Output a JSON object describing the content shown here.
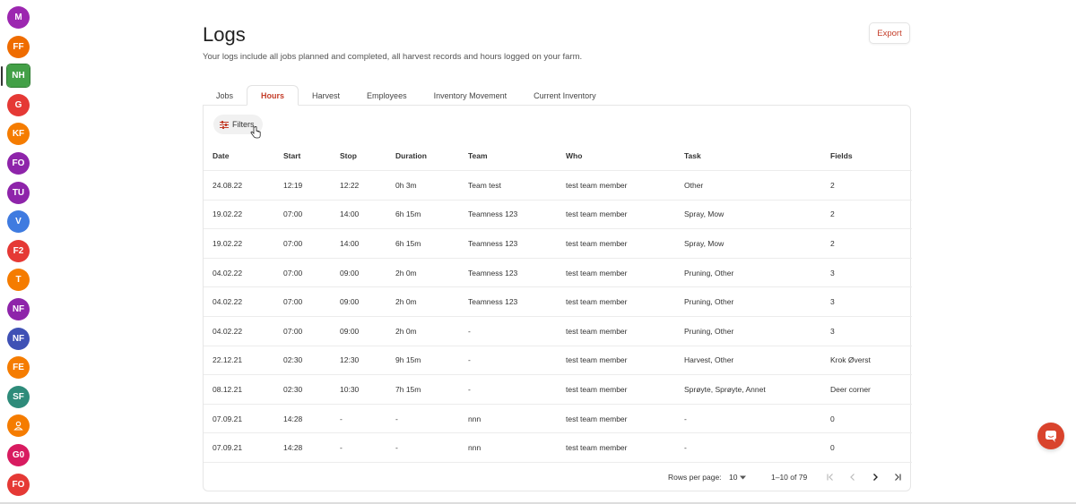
{
  "sidebar": {
    "items": [
      {
        "label": "M",
        "color": "#9c27b0"
      },
      {
        "label": "FF",
        "color": "#ef6c00"
      },
      {
        "label": "NH",
        "color": "#43a047",
        "active": true
      },
      {
        "label": "G",
        "color": "#e53935"
      },
      {
        "label": "KF",
        "color": "#f57c00"
      },
      {
        "label": "FO",
        "color": "#8e24aa"
      },
      {
        "label": "TU",
        "color": "#8e24aa"
      },
      {
        "label": "V",
        "color": "#3f7be0"
      },
      {
        "label": "F2",
        "color": "#e53935"
      },
      {
        "label": "T",
        "color": "#f57c00"
      },
      {
        "label": "NF",
        "color": "#8e24aa"
      },
      {
        "label": "NF",
        "color": "#3f51b5"
      },
      {
        "label": "FE",
        "color": "#f57c00"
      },
      {
        "label": "SF",
        "color": "#2e8b7a"
      },
      {
        "label": "",
        "color": "#f57c00",
        "icon": "user-icon"
      },
      {
        "label": "G0",
        "color": "#d81b60"
      },
      {
        "label": "FO",
        "color": "#e53935"
      }
    ]
  },
  "header": {
    "title": "Logs",
    "subtitle": "Your logs include all jobs planned and completed, all harvest records and hours logged on your farm.",
    "export_label": "Export"
  },
  "tabs": [
    {
      "label": "Jobs",
      "active": false
    },
    {
      "label": "Hours",
      "active": true
    },
    {
      "label": "Harvest",
      "active": false
    },
    {
      "label": "Employees",
      "active": false
    },
    {
      "label": "Inventory Movement",
      "active": false
    },
    {
      "label": "Current Inventory",
      "active": false
    }
  ],
  "filters_label": "Filters",
  "table": {
    "columns": [
      "Date",
      "Start",
      "Stop",
      "Duration",
      "Team",
      "Who",
      "Task",
      "Fields"
    ],
    "rows": [
      [
        "24.08.22",
        "12:19",
        "12:22",
        "0h 3m",
        "Team test",
        "test team member",
        "Other",
        "2"
      ],
      [
        "19.02.22",
        "07:00",
        "14:00",
        "6h 15m",
        "Teamness 123",
        "test team member",
        "Spray, Mow",
        "2"
      ],
      [
        "19.02.22",
        "07:00",
        "14:00",
        "6h 15m",
        "Teamness 123",
        "test team member",
        "Spray, Mow",
        "2"
      ],
      [
        "04.02.22",
        "07:00",
        "09:00",
        "2h 0m",
        "Teamness 123",
        "test team member",
        "Pruning, Other",
        "3"
      ],
      [
        "04.02.22",
        "07:00",
        "09:00",
        "2h 0m",
        "Teamness 123",
        "test team member",
        "Pruning, Other",
        "3"
      ],
      [
        "04.02.22",
        "07:00",
        "09:00",
        "2h 0m",
        "-",
        "test team member",
        "Pruning, Other",
        "3"
      ],
      [
        "22.12.21",
        "02:30",
        "12:30",
        "9h 15m",
        "-",
        "test team member",
        "Harvest, Other",
        "Krok Øverst"
      ],
      [
        "08.12.21",
        "02:30",
        "10:30",
        "7h 15m",
        "-",
        "test team member",
        "Sprøyte, Sprøyte, Annet",
        "Deer corner"
      ],
      [
        "07.09.21",
        "14:28",
        "-",
        "-",
        "nnn",
        "test team member",
        "-",
        "0"
      ],
      [
        "07.09.21",
        "14:28",
        "-",
        "-",
        "nnn",
        "test team member",
        "-",
        "0"
      ]
    ]
  },
  "pagination": {
    "rows_per_page_label": "Rows per page:",
    "rows_per_page_value": "10",
    "range_text": "1–10 of 79"
  },
  "colors": {
    "accent": "#c43e2a",
    "chat": "#d9432c"
  }
}
